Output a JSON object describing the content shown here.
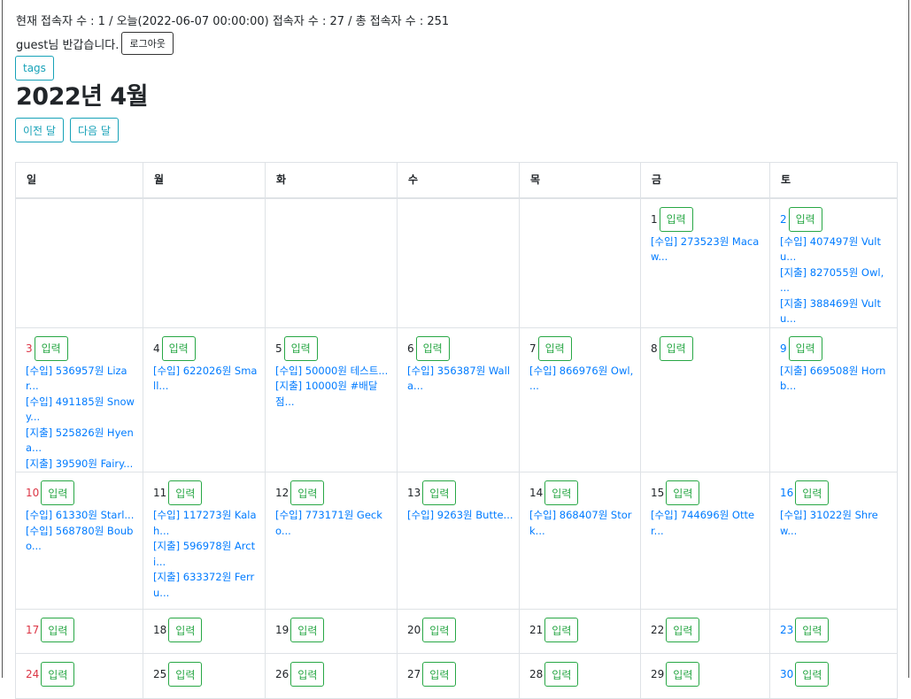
{
  "stats_line": "현재 접속자 수 : 1 / 오늘(2022-06-07 00:00:00) 접속자 수 : 27 / 총 접속자 수 : 251",
  "greeting": "guest님 반갑습니다.",
  "logout_label": "로그아웃",
  "tags_label": "tags",
  "calendar_title": "2022년 4월",
  "prev_label": "이전 달",
  "next_label": "다음 달",
  "input_label": "입력",
  "weekdays": [
    "일",
    "월",
    "화",
    "수",
    "목",
    "금",
    "토"
  ],
  "weeks": [
    [
      null,
      null,
      null,
      null,
      null,
      {
        "day": "1",
        "entries": [
          "[수입] 273523원 Macaw..."
        ]
      },
      {
        "day": "2",
        "entries": [
          "[수입] 407497원 Vultu...",
          "[지출] 827055원 Owl, ...",
          "[지출] 388469원 Vultu..."
        ]
      }
    ],
    [
      {
        "day": "3",
        "entries": [
          "[수입] 536957원 Lizar...",
          "[수입] 491185원 Snowy...",
          "[지출] 525826원 Hyena...",
          "[지출] 39590원 Fairy..."
        ]
      },
      {
        "day": "4",
        "entries": [
          "[수입] 622026원 Small..."
        ]
      },
      {
        "day": "5",
        "entries": [
          "[수입] 50000원 테스트...",
          "[지출] 10000원 #배달 점..."
        ]
      },
      {
        "day": "6",
        "entries": [
          "[수입] 356387원 Walla..."
        ]
      },
      {
        "day": "7",
        "entries": [
          "[수입] 866976원 Owl, ..."
        ]
      },
      {
        "day": "8",
        "entries": []
      },
      {
        "day": "9",
        "entries": [
          "[지출] 669508원 Hornb..."
        ]
      }
    ],
    [
      {
        "day": "10",
        "entries": [
          "[수입] 61330원 Starl...",
          "[수입] 568780원 Boubo..."
        ]
      },
      {
        "day": "11",
        "entries": [
          "[수입] 117273원 Kalah...",
          "[지출] 596978원 Arcti...",
          "[지출] 633372원 Ferru..."
        ]
      },
      {
        "day": "12",
        "entries": [
          "[수입] 773171원 Gecko..."
        ]
      },
      {
        "day": "13",
        "entries": [
          "[수입] 9263원 Butte..."
        ]
      },
      {
        "day": "14",
        "entries": [
          "[수입] 868407원 Stork..."
        ]
      },
      {
        "day": "15",
        "entries": [
          "[수입] 744696원 Otter..."
        ]
      },
      {
        "day": "16",
        "entries": [
          "[수입] 31022원 Shrew..."
        ]
      }
    ],
    [
      {
        "day": "17",
        "entries": []
      },
      {
        "day": "18",
        "entries": []
      },
      {
        "day": "19",
        "entries": []
      },
      {
        "day": "20",
        "entries": []
      },
      {
        "day": "21",
        "entries": []
      },
      {
        "day": "22",
        "entries": []
      },
      {
        "day": "23",
        "entries": []
      }
    ],
    [
      {
        "day": "24",
        "entries": []
      },
      {
        "day": "25",
        "entries": []
      },
      {
        "day": "26",
        "entries": []
      },
      {
        "day": "27",
        "entries": []
      },
      {
        "day": "28",
        "entries": []
      },
      {
        "day": "29",
        "entries": []
      },
      {
        "day": "30",
        "entries": []
      }
    ]
  ],
  "colors": {
    "sunday": "#dc3545",
    "saturday": "#007bff",
    "entry": "#007bff",
    "input_button": "#28a745",
    "nav_button": "#17a2b8"
  }
}
